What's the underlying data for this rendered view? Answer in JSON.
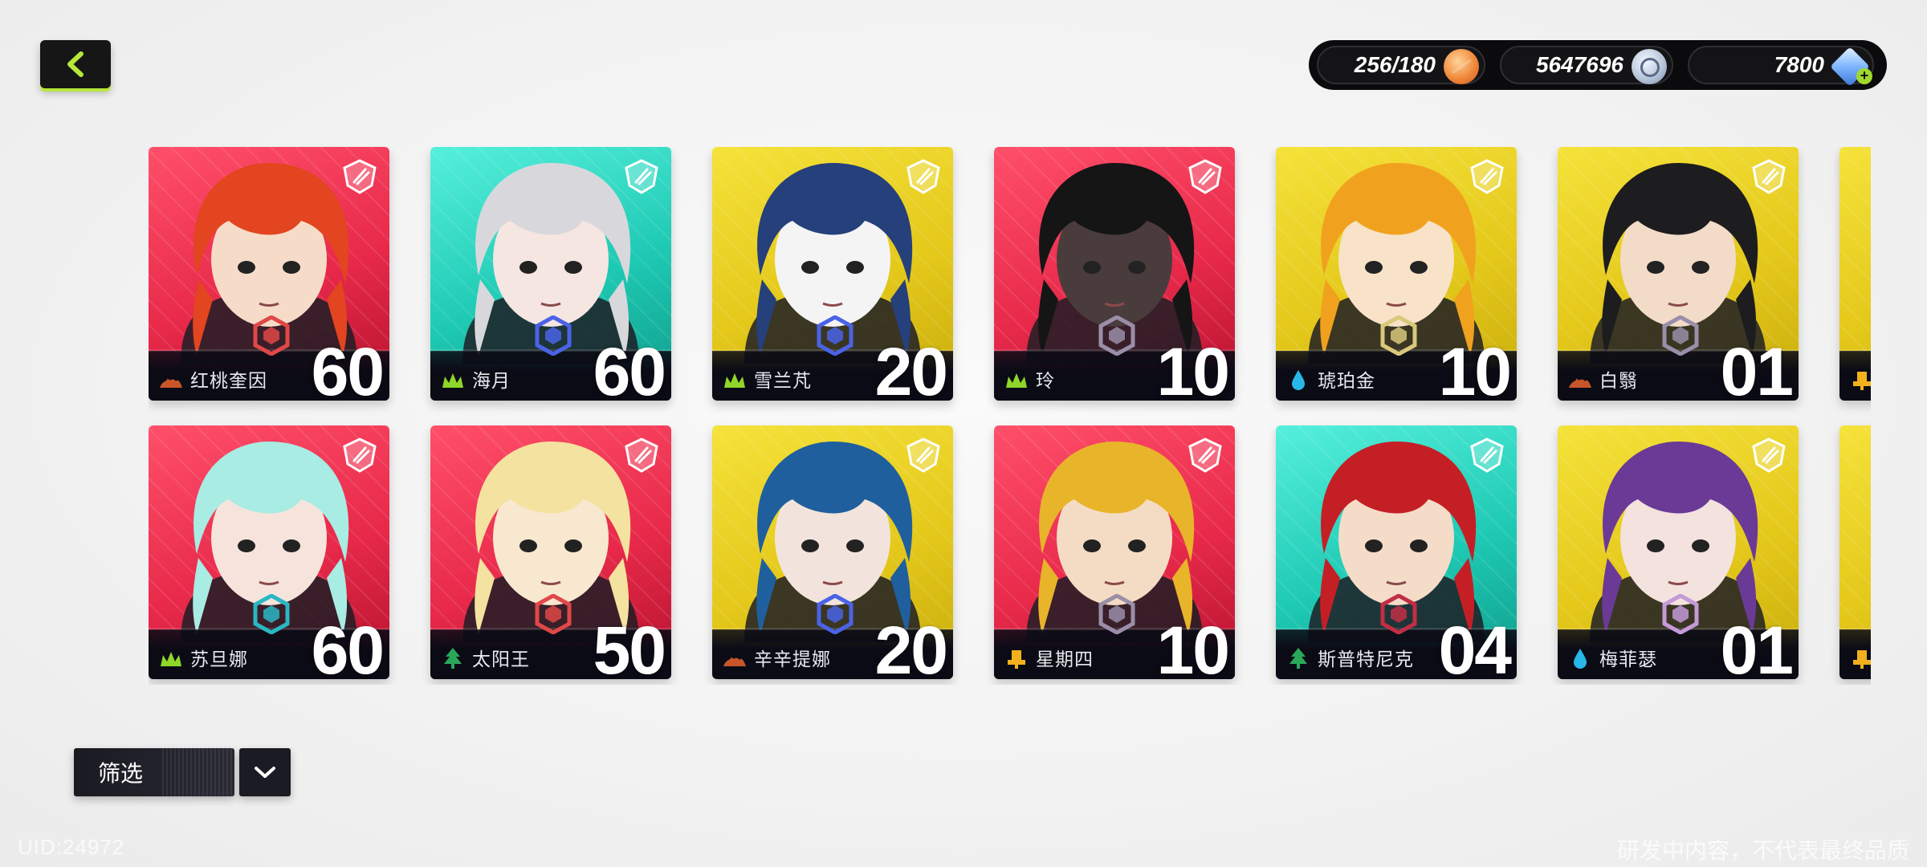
{
  "currencies": [
    {
      "value": "256/180",
      "icon": "stamina-orb-icon"
    },
    {
      "value": "5647696",
      "icon": "silver-coin-icon"
    },
    {
      "value": "7800",
      "icon": "crystal-gem-icon",
      "has_plus": true
    }
  ],
  "characters": [
    {
      "name": "红桃奎因",
      "level": "60",
      "bg": "red",
      "element": "fire",
      "rank_color": "#e04848",
      "hair": "#e2451f",
      "skin": "#f6dcc8"
    },
    {
      "name": "海月",
      "level": "60",
      "bg": "teal",
      "element": "grass",
      "rank_color": "#4a63e6",
      "hair": "#d8d8dc",
      "skin": "#f5e6e2"
    },
    {
      "name": "雪兰芃",
      "level": "20",
      "bg": "yellow",
      "element": "grass",
      "rank_color": "#4a63e6",
      "hair": "#25407a",
      "skin": "#f4f4f4"
    },
    {
      "name": "玲",
      "level": "10",
      "bg": "red",
      "element": "grass",
      "rank_color": "#9a8ea8",
      "hair": "#151515",
      "skin": "#4a3c3c"
    },
    {
      "name": "琥珀金",
      "level": "10",
      "bg": "yellow",
      "element": "water",
      "rank_color": "#d8c87a",
      "hair": "#f0a21e",
      "skin": "#f8e2c8"
    },
    {
      "name": "白翳",
      "level": "01",
      "bg": "yellow",
      "element": "fire",
      "rank_color": "#9a8ea8",
      "hair": "#1d1d1f",
      "skin": "#f2dcc8"
    },
    {
      "name": "苏旦娜",
      "level": "60",
      "bg": "red",
      "element": "grass",
      "rank_color": "#2ab7c4",
      "hair": "#a8ece4",
      "skin": "#f6e4dc"
    },
    {
      "name": "太阳王",
      "level": "50",
      "bg": "red",
      "element": "tree",
      "rank_color": "#e04848",
      "hair": "#f4e2a0",
      "skin": "#f8e8d0"
    },
    {
      "name": "辛辛提娜",
      "level": "20",
      "bg": "yellow",
      "element": "fire",
      "rank_color": "#4a63e6",
      "hair": "#1f5f9e",
      "skin": "#f2e4dc"
    },
    {
      "name": "星期四",
      "level": "10",
      "bg": "red",
      "element": "earth",
      "rank_color": "#9a8ea8",
      "hair": "#e8b42a",
      "skin": "#f4dcc4"
    },
    {
      "name": "斯普特尼克",
      "level": "04",
      "bg": "teal",
      "element": "tree",
      "rank_color": "#c22e44",
      "hair": "#c51f26",
      "skin": "#f4dcc8"
    },
    {
      "name": "梅菲瑟",
      "level": "01",
      "bg": "yellow",
      "element": "water",
      "rank_color": "#c49ad8",
      "hair": "#6a3a96",
      "skin": "#f4e2de"
    }
  ],
  "partial_column": [
    {
      "bg": "yellow",
      "element": "earth"
    },
    {
      "bg": "yellow",
      "element": "earth"
    }
  ],
  "filter": {
    "label": "筛选"
  },
  "watermark": {
    "uid": "UID:24972",
    "note": "研发中内容，不代表最终品质"
  },
  "colors": {
    "accent": "#b7e63a",
    "fire": "#c8552a",
    "grass": "#8fd62a",
    "water": "#27b7e8",
    "tree": "#2aa85a",
    "earth": "#f2b01c"
  }
}
